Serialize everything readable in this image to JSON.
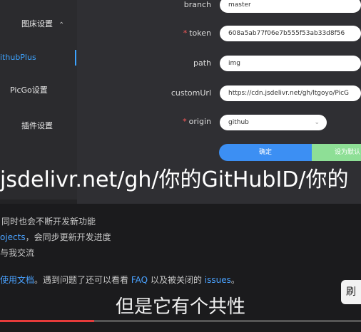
{
  "sidebar": {
    "items": [
      {
        "label": "图床设置"
      },
      {
        "label": "ithubPlus"
      },
      {
        "label": "PicGo设置"
      },
      {
        "label": "插件设置"
      }
    ]
  },
  "form": {
    "branch": {
      "label": "branch",
      "value": "master"
    },
    "token": {
      "label": "token",
      "value": "608a5ab77f06e7b555f53ab33d8f56"
    },
    "path": {
      "label": "path",
      "value": "img"
    },
    "customUrl": {
      "label": "customUrl",
      "value": "https://cdn.jsdelivr.net/gh/ltgoyo/PicG"
    },
    "origin": {
      "label": "origin",
      "value": "github"
    },
    "confirm_label": "确定",
    "default_label": "设为默认"
  },
  "overlay_subtitle": "jsdelivr.net/gh/你的GitHubID/你的",
  "background_text": {
    "line1": "同时也会不断开发新功能",
    "line2_link": "ojects",
    "line2_rest": "，会同步更新开发进度",
    "line3": "与我交流",
    "line4_link1": "使用文档",
    "line4_mid1": "。遇到问题了还可以看看",
    "line4_link2": "FAQ",
    "line4_mid2": "以及被关闭的",
    "line4_link3": "issues",
    "line4_end": "。"
  },
  "bottom_subtitle": "但是它有个共性",
  "side_badge": "刷",
  "colors": {
    "accent": "#3c8ff3",
    "link": "#4aa2ff",
    "progress": "#e63b3b"
  },
  "progress_fraction": 0.26
}
